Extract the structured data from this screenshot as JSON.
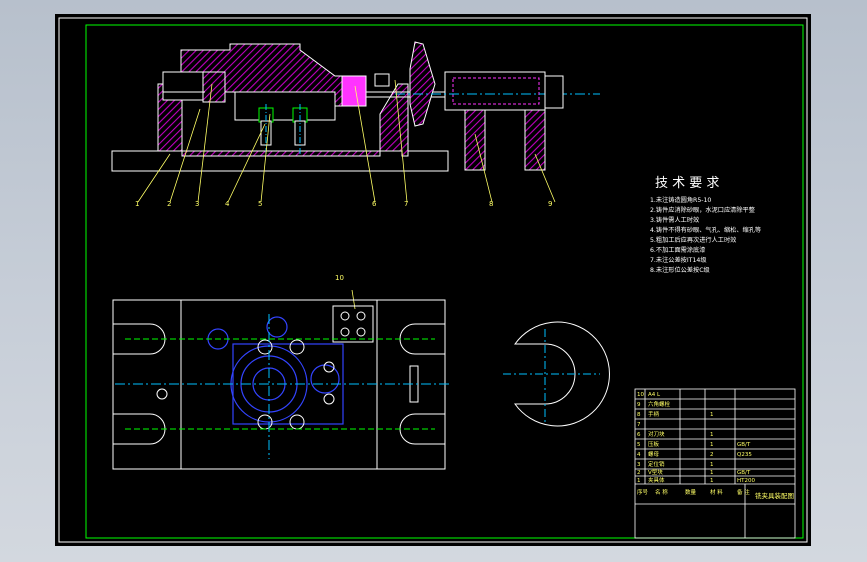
{
  "colors": {
    "background": "#000000",
    "border": "#ffffff",
    "frame": "#00ff00",
    "hatch": "#c000c0",
    "magenta": "#ff33ff",
    "part_line": "#ffffff",
    "center_line": "#00bfff",
    "blue_part": "#3344ff",
    "leader": "#ffff66",
    "text": "#ffffff",
    "table_text": "#ffff66"
  },
  "part_callouts": [
    "1",
    "2",
    "3",
    "4",
    "5",
    "6",
    "7",
    "8",
    "9",
    "10"
  ],
  "section_label": "1",
  "tech_req": {
    "title": "技 术 要 求",
    "items": [
      "1.未注铸造圆角R5-10",
      "2.铸件应消除砂眼，水泥口应清除平整",
      "3.铸件需人工时效",
      "4.铸件不得有砂眼、气孔、缩松、缩孔等",
      "5.粗加工后应再次进行人工时效",
      "6.不加工面需涂底漆",
      "7.未注公差按IT14级",
      "8.未注形位公差按C级"
    ]
  },
  "bom": {
    "rows": [
      [
        "10",
        "A4 L",
        "",
        "",
        ""
      ],
      [
        "9",
        "六角螺栓",
        "",
        "",
        ""
      ],
      [
        "8",
        "手柄",
        "",
        "1",
        ""
      ],
      [
        "7",
        "",
        "",
        "",
        ""
      ],
      [
        "6",
        "对刀块",
        "",
        "1",
        ""
      ],
      [
        "5",
        "压板",
        "",
        "1",
        "GB/T"
      ],
      [
        "4",
        "螺母",
        "",
        "2",
        "Q235"
      ],
      [
        "3",
        "定位销",
        "",
        "1",
        ""
      ],
      [
        "2",
        "V型块",
        "",
        "1",
        "GB/T"
      ],
      [
        "1",
        "夹具体",
        "",
        "1",
        "HT200"
      ]
    ],
    "header": [
      "序号",
      "名 称",
      "数量",
      "材 料",
      "备 注"
    ],
    "title": "铣夹具装配图"
  }
}
